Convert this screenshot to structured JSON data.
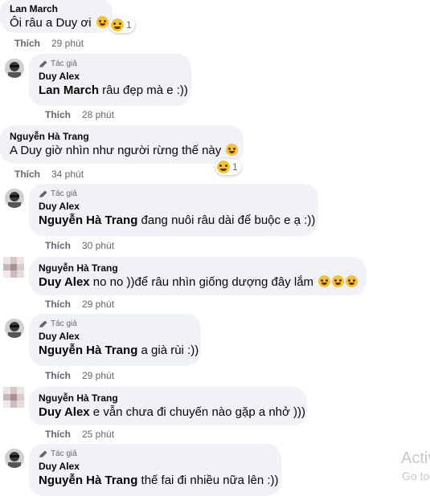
{
  "comments": [
    {
      "author": "Lan March",
      "mention": "",
      "text": "Ôi râu a Duy ơi",
      "emoji": "laugh",
      "reaction_count": "1",
      "like": "Thích",
      "time": "29 phút"
    },
    {
      "role": "Tác giả",
      "author": "Duy Alex",
      "mention": "Lan March",
      "text": " râu đẹp mà e :))",
      "like": "Thích",
      "time": "28 phút"
    },
    {
      "author": "Nguyễn Hà Trang",
      "mention": "",
      "text": "A Duy giờ nhìn như người rừng thế này",
      "emoji": "rofl",
      "reaction_count": "1",
      "like": "Thích",
      "time": "34 phút"
    },
    {
      "role": "Tác giả",
      "author": "Duy Alex",
      "mention": "Nguyễn Hà Trang",
      "text": " đang nuôi râu dài để buộc e ạ :))",
      "like": "Thích",
      "time": "30 phút"
    },
    {
      "author": "Nguyễn Hà Trang",
      "mention": "Duy Alex",
      "text": " no no ))để râu nhìn giống dượng đây lắm",
      "emoji": "rofl x3",
      "like": "Thích",
      "time": "29 phút"
    },
    {
      "role": "Tác giả",
      "author": "Duy Alex",
      "mention": "Nguyễn Hà Trang",
      "text": " a già rùi :))",
      "like": "Thích",
      "time": "29 phút"
    },
    {
      "author": "Nguyễn Hà Trang",
      "mention": "Duy Alex",
      "text": " e vẫn chưa đi chuyến nào gặp a nhở )))",
      "like": "Thích",
      "time": "25 phút"
    },
    {
      "role": "Tác giả",
      "author": "Duy Alex",
      "mention": "Nguyễn Hà Trang",
      "text": " thế fai đi nhiều nữa lên :))"
    }
  ],
  "watermark": {
    "line1": "Activ",
    "line2": "Go to"
  },
  "colors": {
    "bubble": "#f0f2f5",
    "meta": "#65676b",
    "emoji": "#f7c033"
  }
}
